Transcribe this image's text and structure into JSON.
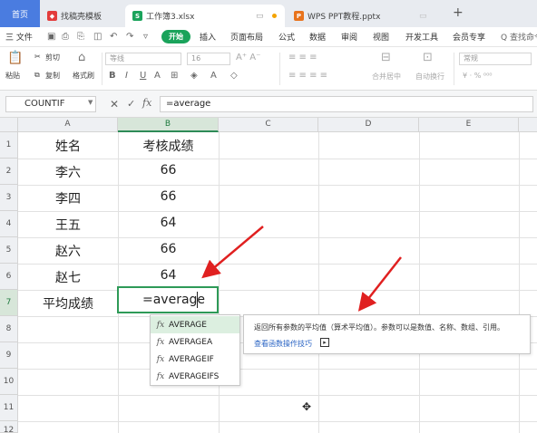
{
  "tabs": {
    "home": "首页",
    "t1": "找稿壳模板",
    "t2": "工作簿3.xlsx",
    "t3": "WPS PPT教程.pptx",
    "plus": "+"
  },
  "menu": {
    "file": "三 文件",
    "start": "开始",
    "items": [
      "插入",
      "页面布局",
      "公式",
      "数据",
      "审阅",
      "视图",
      "开发工具",
      "会员专享"
    ],
    "search": "Q 查找命令"
  },
  "ribbon": {
    "cut": "剪切",
    "copy": "复制",
    "format_painter": "格式刷",
    "paste": "粘贴",
    "font": "等线",
    "size": "16",
    "merge": "合并居中",
    "wrap": "自动换行",
    "number_format": "常规"
  },
  "formula_bar": {
    "name_box": "COUNTIF",
    "fx": "fx",
    "formula": "=average"
  },
  "columns": [
    "A",
    "B",
    "C",
    "D",
    "E"
  ],
  "rows": [
    "1",
    "2",
    "3",
    "4",
    "5",
    "6",
    "7",
    "8",
    "9",
    "10",
    "11",
    "12"
  ],
  "cells": {
    "a1": "姓名",
    "b1": "考核成绩",
    "a2": "李六",
    "b2": "66",
    "a3": "李四",
    "b3": "66",
    "a4": "王五",
    "b4": "64",
    "a5": "赵六",
    "b5": "66",
    "a6": "赵七",
    "b6": "64",
    "a7": "平均成绩",
    "b7": "=average"
  },
  "autocomplete": [
    "AVERAGE",
    "AVERAGEA",
    "AVERAGEIF",
    "AVERAGEIFS"
  ],
  "tooltip": {
    "description": "返回所有参数的平均值（算术平均值）。参数可以是数值、名称、数组、引用。",
    "link": "查看函数操作技巧"
  },
  "colors": {
    "accent": "#2e9a57",
    "tab_home": "#4a7ce0",
    "arrow": "#e02020"
  }
}
